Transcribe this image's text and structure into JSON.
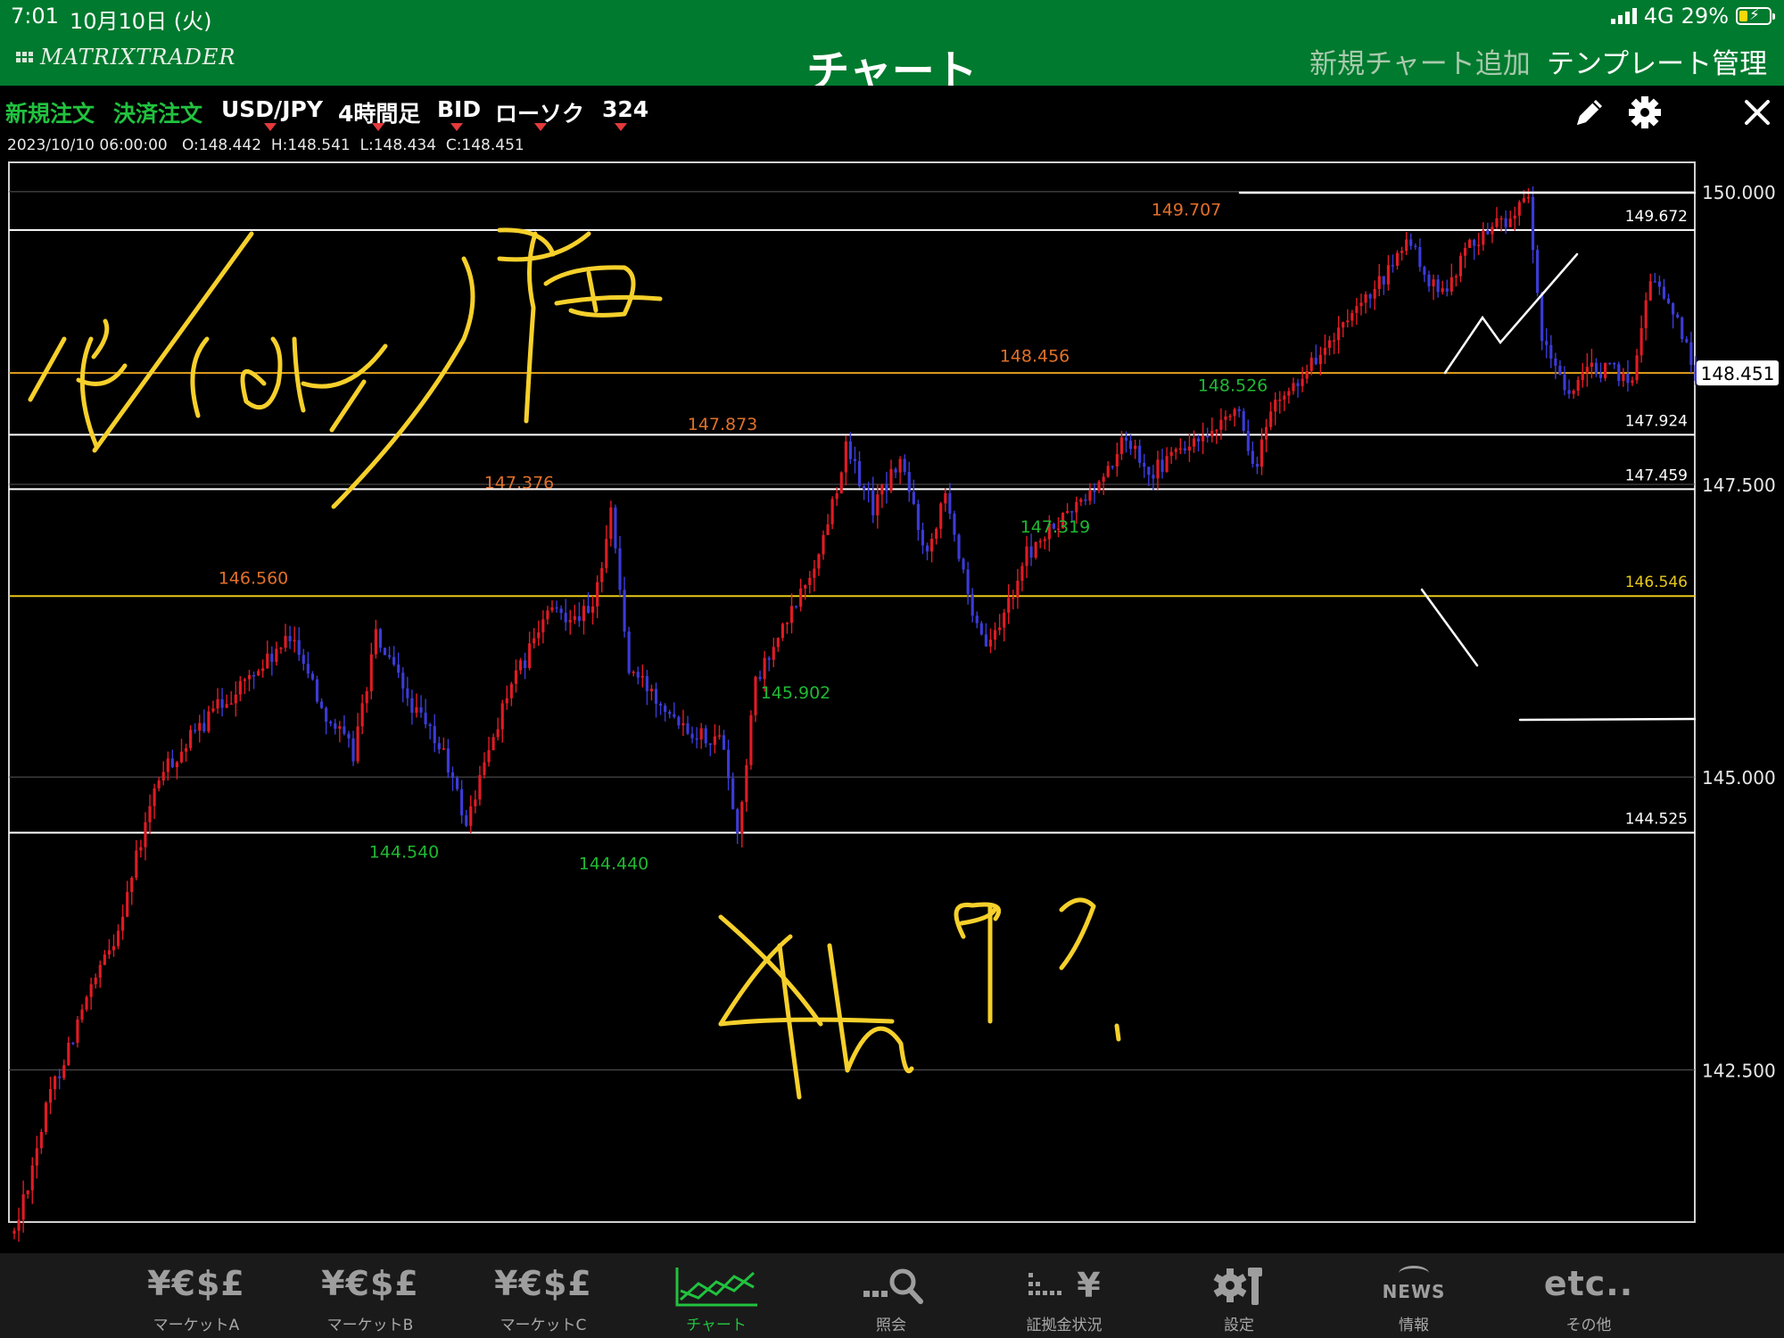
{
  "status_bar": {
    "time": "7:01",
    "date": "10月10日 (火)",
    "network": "4G",
    "battery": "29%",
    "battery_level": 0.29
  },
  "header": {
    "logo": "MATRIXTRADER",
    "title": "チャート",
    "add_chart": "新規チャート追加",
    "template_manage": "テンプレート管理"
  },
  "toolbar": {
    "new_order": "新規注文",
    "settle_order": "決済注文",
    "symbol": "USD/JPY",
    "timeframe": "4時間足",
    "price_type": "BID",
    "chart_style": "ローソク",
    "bar_count": "324"
  },
  "ohlc": {
    "time": "2023/10/10 06:00:00",
    "open": "O:148.442",
    "high": "H:148.541",
    "low": "L:148.434",
    "close": "C:148.451"
  },
  "chart_data": {
    "type": "candlestick",
    "symbol": "USD/JPY",
    "timeframe": "4時間足",
    "ylim": [
      141.2,
      150.25
    ],
    "y_ticks": [
      "150.000",
      "147.500",
      "145.000",
      "142.500"
    ],
    "last_price": "148.451",
    "horizontal_lines": [
      {
        "value": 149.672,
        "label": "149.672",
        "color": "#ffffff"
      },
      {
        "value": 148.451,
        "label": "",
        "color": "#e6a11c"
      },
      {
        "value": 147.924,
        "label": "147.924",
        "color": "#ffffff"
      },
      {
        "value": 147.459,
        "label": "147.459",
        "color": "#ffffff"
      },
      {
        "value": 146.546,
        "label": "146.546",
        "color": "#e8c81a"
      },
      {
        "value": 144.525,
        "label": "144.525",
        "color": "#ffffff"
      }
    ],
    "annotations": [
      {
        "label": "149.707",
        "kind": "high",
        "price": 149.707
      },
      {
        "label": "148.456",
        "kind": "high",
        "price": 148.456
      },
      {
        "label": "147.873",
        "kind": "high",
        "price": 147.873
      },
      {
        "label": "147.376",
        "kind": "high",
        "price": 147.376
      },
      {
        "label": "146.560",
        "kind": "high",
        "price": 146.56
      },
      {
        "label": "148.526",
        "kind": "low",
        "price": 148.526
      },
      {
        "label": "147.319",
        "kind": "low",
        "price": 147.319
      },
      {
        "label": "145.902",
        "kind": "low",
        "price": 145.902
      },
      {
        "label": "144.540",
        "kind": "low",
        "price": 144.54
      },
      {
        "label": "144.440",
        "kind": "low",
        "price": 144.44
      }
    ],
    "anchors": [
      [
        0,
        141.1
      ],
      [
        8,
        142.3
      ],
      [
        15,
        143.0
      ],
      [
        22,
        143.6
      ],
      [
        32,
        145.0
      ],
      [
        45,
        145.6
      ],
      [
        62,
        146.2
      ],
      [
        68,
        145.6
      ],
      [
        75,
        145.2
      ],
      [
        80,
        146.2
      ],
      [
        88,
        145.6
      ],
      [
        95,
        145.2
      ],
      [
        100,
        144.6
      ],
      [
        108,
        145.6
      ],
      [
        118,
        146.4
      ],
      [
        128,
        146.4
      ],
      [
        132,
        147.3
      ],
      [
        136,
        145.9
      ],
      [
        142,
        145.7
      ],
      [
        150,
        145.4
      ],
      [
        157,
        145.3
      ],
      [
        160,
        144.5
      ],
      [
        164,
        145.8
      ],
      [
        172,
        146.4
      ],
      [
        178,
        146.9
      ],
      [
        184,
        147.8
      ],
      [
        190,
        147.3
      ],
      [
        196,
        147.7
      ],
      [
        202,
        146.9
      ],
      [
        206,
        147.5
      ],
      [
        212,
        146.3
      ],
      [
        216,
        146.1
      ],
      [
        224,
        146.9
      ],
      [
        232,
        147.2
      ],
      [
        240,
        147.5
      ],
      [
        246,
        147.9
      ],
      [
        252,
        147.6
      ],
      [
        258,
        147.8
      ],
      [
        266,
        147.9
      ],
      [
        270,
        148.2
      ],
      [
        274,
        147.6
      ],
      [
        278,
        148.1
      ],
      [
        286,
        148.5
      ],
      [
        296,
        148.9
      ],
      [
        304,
        149.3
      ],
      [
        308,
        149.6
      ],
      [
        315,
        149.1
      ],
      [
        323,
        149.6
      ],
      [
        335,
        149.9
      ],
      [
        338,
        148.7
      ],
      [
        344,
        148.3
      ],
      [
        350,
        148.5
      ],
      [
        358,
        148.4
      ],
      [
        362,
        149.3
      ],
      [
        368,
        148.9
      ],
      [
        372,
        148.451
      ]
    ]
  },
  "handwriting": {
    "date_note": "10/10(火) 朝",
    "timeframe_note": "4h 4?"
  },
  "tabs": [
    {
      "icon": "¥€$£",
      "label": "マーケットA"
    },
    {
      "icon": "¥€$£",
      "label": "マーケットB"
    },
    {
      "icon": "¥€$£",
      "label": "マーケットC"
    },
    {
      "icon": "",
      "label": "チャート",
      "active": true
    },
    {
      "icon": "",
      "label": "照会"
    },
    {
      "icon": "¥",
      "label": "証拠金状況"
    },
    {
      "icon": "",
      "label": "設定"
    },
    {
      "icon": "NEWS",
      "label": "情報"
    },
    {
      "icon": "etc..",
      "label": "その他"
    }
  ]
}
